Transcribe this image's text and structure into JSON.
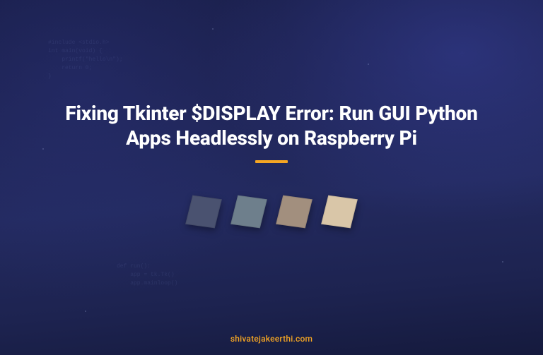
{
  "hero": {
    "title": "Fixing Tkinter $DISPLAY Error: Run GUI Python Apps Headlessly on Raspberry Pi"
  },
  "footer": {
    "site": "shivatejakeerthi.com"
  },
  "accent": {
    "underline_color": "#f5a623",
    "footer_color": "#f5a623"
  },
  "decor": {
    "squares": [
      {
        "color": "#4a5270"
      },
      {
        "color": "#6e7f8c"
      },
      {
        "color": "#a28f7e"
      },
      {
        "color": "#d9c6a8"
      }
    ],
    "bg_code_top": "#include <stdio.h>\nint main(void) {\n    printf(\"hello\\n\");\n    return 0;\n}",
    "bg_code_bottom": "def run():\n    app = tk.Tk()\n    app.mainloop()"
  }
}
